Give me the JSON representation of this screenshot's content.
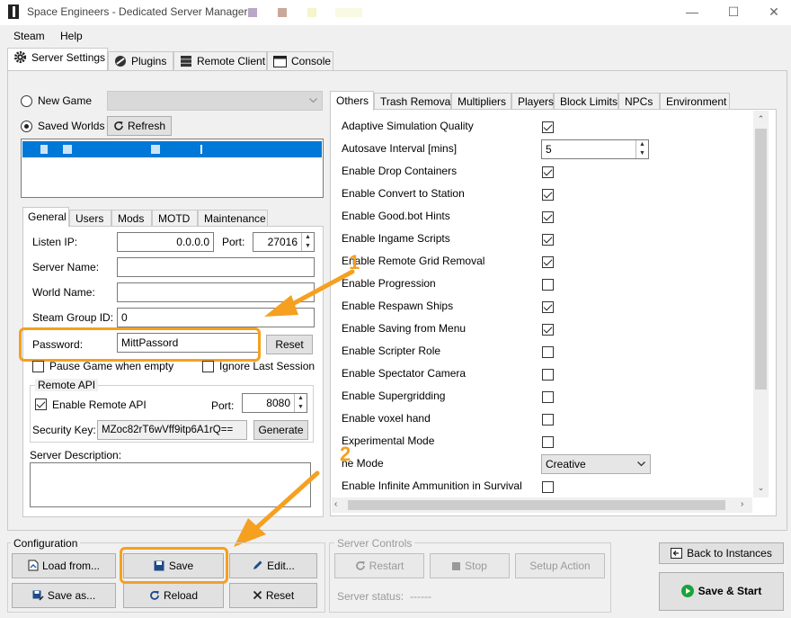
{
  "window": {
    "title": "Space Engineers - Dedicated Server Manager - ",
    "minimize": "—",
    "maximize": "☐",
    "close": "✕"
  },
  "menu": [
    "Steam",
    "Help"
  ],
  "main_tabs": [
    "Server Settings",
    "Plugins",
    "Remote Client",
    "Console"
  ],
  "world": {
    "new_game_label": "New Game",
    "saved_worlds_label": "Saved Worlds",
    "refresh_label": "Refresh"
  },
  "sub_tabs": [
    "General",
    "Users",
    "Mods",
    "MOTD",
    "Maintenance"
  ],
  "general": {
    "listen_ip_label": "Listen IP:",
    "listen_ip_value": "0.0.0.0",
    "port_label": "Port:",
    "port_value": "27016",
    "server_name_label": "Server Name:",
    "server_name_value": "",
    "world_name_label": "World Name:",
    "world_name_value": "",
    "steam_group_label": "Steam Group ID:",
    "steam_group_value": "0",
    "password_label": "Password:",
    "password_value": "MittPassord",
    "reset_label": "Reset",
    "pause_label": "Pause Game when empty",
    "ignore_label": "Ignore Last Session",
    "remote_api_title": "Remote API",
    "enable_remote_label": "Enable Remote API",
    "remote_port_label": "Port:",
    "remote_port_value": "8080",
    "security_key_label": "Security Key:",
    "security_key_value": "MZoc82rT6wVff9itp6A1rQ==",
    "generate_label": "Generate",
    "description_label": "Server Description:"
  },
  "settings_tabs": [
    "Others",
    "Trash Removal",
    "Multipliers",
    "Players",
    "Block Limits",
    "NPCs",
    "Environment"
  ],
  "settings_rows": [
    {
      "label": "Adaptive Simulation Quality",
      "type": "check",
      "checked": true
    },
    {
      "label": "Autosave Interval [mins]",
      "type": "number",
      "value": "5"
    },
    {
      "label": "Enable Drop Containers",
      "type": "check",
      "checked": true
    },
    {
      "label": "Enable Convert to Station",
      "type": "check",
      "checked": true
    },
    {
      "label": "Enable Good.bot Hints",
      "type": "check",
      "checked": true
    },
    {
      "label": "Enable Ingame Scripts",
      "type": "check",
      "checked": true
    },
    {
      "label": "Enable Remote Grid Removal",
      "type": "check",
      "checked": true
    },
    {
      "label": "Enable Progression",
      "type": "check",
      "checked": false
    },
    {
      "label": "Enable Respawn Ships",
      "type": "check",
      "checked": true
    },
    {
      "label": "Enable Saving from Menu",
      "type": "check",
      "checked": true
    },
    {
      "label": "Enable Scripter Role",
      "type": "check",
      "checked": false
    },
    {
      "label": "Enable Spectator Camera",
      "type": "check",
      "checked": false
    },
    {
      "label": "Enable Supergridding",
      "type": "check",
      "checked": false
    },
    {
      "label": "Enable voxel hand",
      "type": "check",
      "checked": false
    },
    {
      "label": "Experimental Mode",
      "type": "check",
      "checked": false
    },
    {
      "label": "ne Mode",
      "type": "select",
      "value": "Creative"
    },
    {
      "label": "Enable Infinite Ammunition in Survival",
      "type": "check",
      "checked": false
    }
  ],
  "configuration": {
    "title": "Configuration",
    "load_label": "Load from...",
    "save_label": "Save",
    "edit_label": "Edit...",
    "save_as_label": "Save as...",
    "reload_label": "Reload",
    "reset_label": "Reset"
  },
  "server_controls": {
    "title": "Server Controls",
    "restart_label": "Restart",
    "stop_label": "Stop",
    "setup_label": "Setup Action",
    "status_label": "Server status:",
    "status_value": "------"
  },
  "back_label": "Back to Instances",
  "save_start_label": "Save & Start",
  "annotations": [
    "1",
    "2"
  ],
  "colors": {
    "accent_orange": "#f5a020",
    "selection_blue": "#0078d7",
    "start_green": "#1aa33a"
  }
}
